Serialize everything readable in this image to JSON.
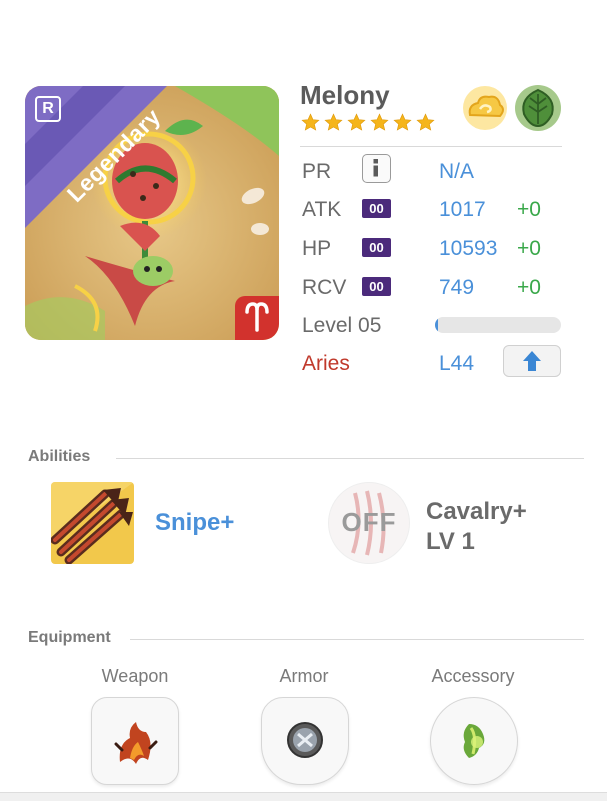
{
  "monster": {
    "rarity": "Legendary",
    "name": "Melony",
    "star_count": 6,
    "rarity_badge": "R"
  },
  "stats": {
    "pr": {
      "label": "PR",
      "value": "N/A"
    },
    "atk": {
      "label": "ATK",
      "badge": "00",
      "value": "1017",
      "plus": "+0"
    },
    "hp": {
      "label": "HP",
      "badge": "00",
      "value": "10593",
      "plus": "+0"
    },
    "rcv": {
      "label": "RCV",
      "badge": "00",
      "value": "749",
      "plus": "+0"
    },
    "level": {
      "label": "Level 05",
      "progress": 0.02
    },
    "zodiac": {
      "label": "Aries",
      "value": "L44"
    }
  },
  "abilities": {
    "title": "Abilities",
    "items": [
      {
        "name": "Snipe+"
      },
      {
        "state": "OFF",
        "name_line1": "Cavalry+",
        "name_line2": "LV 1"
      }
    ]
  },
  "equipment": {
    "title": "Equipment",
    "slots": [
      {
        "label": "Weapon"
      },
      {
        "label": "Armor"
      },
      {
        "label": "Accessory"
      }
    ]
  },
  "colors": {
    "accent_blue": "#4a90d9",
    "plus_green": "#3aa84a",
    "zodiac_red": "#c0392b",
    "badge_purple": "#4b2a7b",
    "rarity_ribbon": "#7e6cc4"
  },
  "icons": {
    "elements": [
      "light-element-icon",
      "wood-element-icon"
    ],
    "zodiac": "aries-icon",
    "info": "info-icon",
    "upgrade": "up-arrow-icon"
  }
}
